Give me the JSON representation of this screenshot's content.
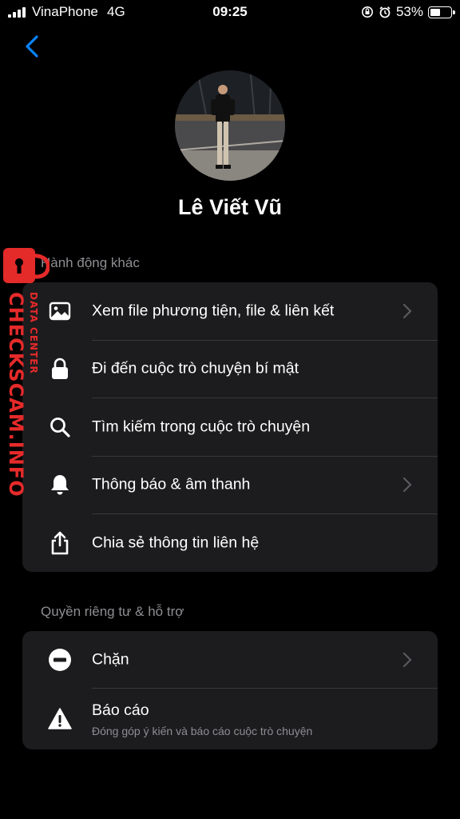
{
  "status_bar": {
    "carrier": "VinaPhone",
    "network": "4G",
    "time": "09:25",
    "battery_percent": "53%",
    "battery_level": 0.53
  },
  "profile": {
    "name": "Lê Viết Vũ"
  },
  "sections": {
    "other_actions": {
      "title": "Hành động khác",
      "items": [
        {
          "label": "Xem file phương tiện, file & liên kết",
          "icon": "image-icon",
          "has_chevron": true
        },
        {
          "label": "Đi đến cuộc trò chuyện bí mật",
          "icon": "lock-icon",
          "has_chevron": false
        },
        {
          "label": "Tìm kiếm trong cuộc trò chuyện",
          "icon": "search-icon",
          "has_chevron": false
        },
        {
          "label": "Thông báo & âm thanh",
          "icon": "bell-icon",
          "has_chevron": true
        },
        {
          "label": "Chia sẻ thông tin liên hệ",
          "icon": "share-icon",
          "has_chevron": false
        }
      ]
    },
    "privacy_support": {
      "title": "Quyền riêng tư & hỗ trợ",
      "items": [
        {
          "label": "Chặn",
          "icon": "block-icon",
          "has_chevron": true
        },
        {
          "label": "Báo cáo",
          "sublabel": "Đóng góp ý kiến và báo cáo cuộc trò chuyện",
          "icon": "warning-icon",
          "has_chevron": false
        }
      ]
    }
  },
  "watermark": {
    "brand": "CHECKSCAM.INFO",
    "tagline": "DATA CENTER",
    "color": "#e52a2a"
  },
  "colors": {
    "background": "#000000",
    "card": "#1c1c1e",
    "accent": "#0a84ff",
    "secondary_text": "#8e8e93"
  }
}
